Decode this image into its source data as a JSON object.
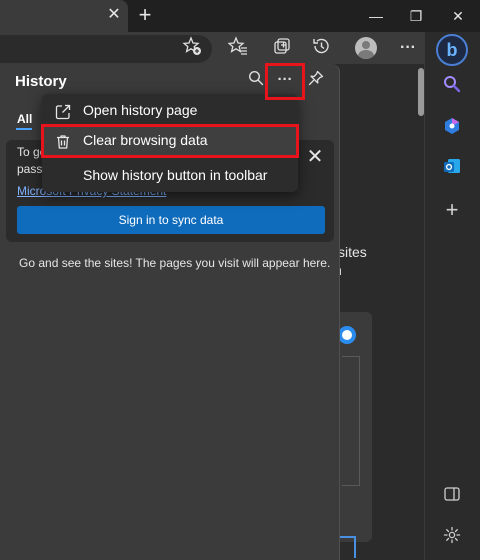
{
  "titlebar": {
    "tab_close": "✕",
    "new_tab": "+",
    "minimize": "—",
    "restore": "❐",
    "close": "✕"
  },
  "toolbar": {
    "favorite_icon": "star-add-icon",
    "favorites_icon": "favorites-icon",
    "collections_icon": "collections-icon",
    "history_icon": "history-icon",
    "more": "···"
  },
  "history_panel": {
    "title": "History",
    "search_icon": "search-icon",
    "more_icon": "···",
    "pin_icon": "pin-icon",
    "filter_all": "All",
    "sync_card": {
      "text_line1": "To ge",
      "text_line2": "passv",
      "privacy_link": "Microsoft Privacy Statement",
      "close": "✕",
      "sign_in_button": "Sign in to sync data"
    },
    "empty_message": "Go and see the sites! The pages you visit will appear here."
  },
  "menu": {
    "items": [
      {
        "label": "Open history page",
        "icon": "open-external-icon"
      },
      {
        "label": "Clear browsing data",
        "icon": "trash-icon"
      },
      {
        "label": "Show history button in toolbar",
        "icon": ""
      }
    ]
  },
  "page_behind": {
    "sites_fragment": "sites",
    "n_fragment": "n"
  },
  "sidebar": {
    "add": "+"
  },
  "colors": {
    "highlight": "#e8141c",
    "accent": "#0f6cbd",
    "panel_bg": "#3b3b3b",
    "menu_bg": "#2c2c2c"
  }
}
